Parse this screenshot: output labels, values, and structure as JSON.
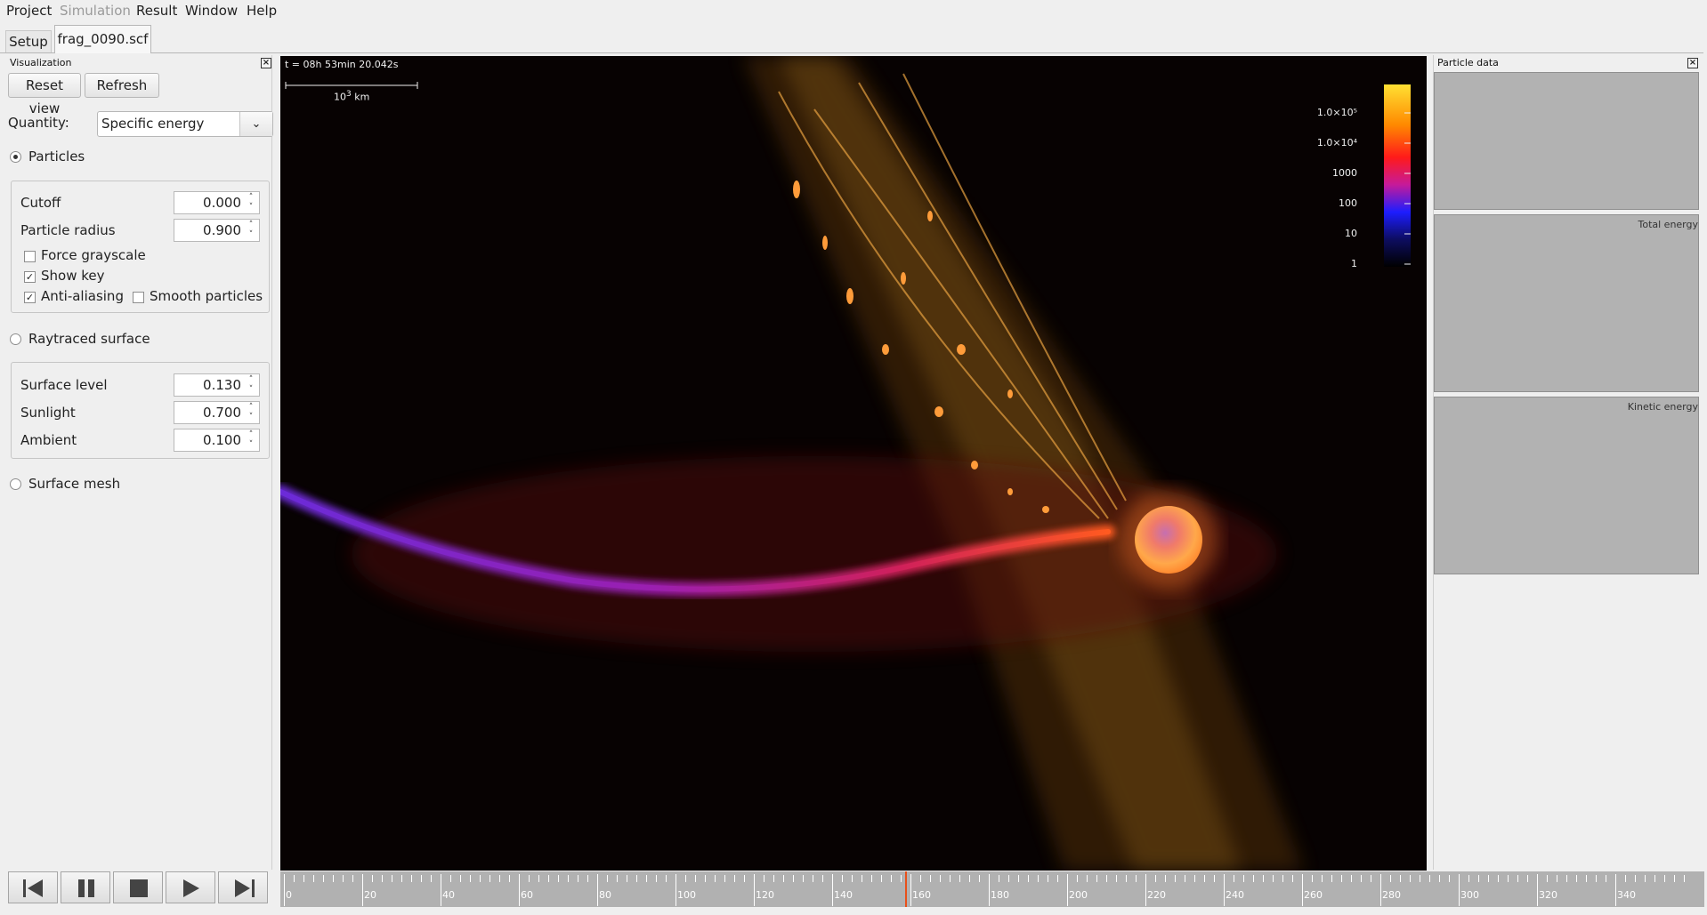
{
  "menu": [
    "Project",
    "Simulation",
    "Result",
    "Window",
    "Help"
  ],
  "tabs": {
    "setup": "Setup",
    "file": "frag_0090.scf"
  },
  "left_panel": {
    "title": "Visualization",
    "reset_view": "Reset view",
    "refresh": "Refresh",
    "quantity_label": "Quantity:",
    "quantity_value": "Specific energy",
    "particles_label": "Particles",
    "cutoff_label": "Cutoff",
    "cutoff_value": "0.000",
    "radius_label": "Particle radius",
    "radius_value": "0.900",
    "force_grayscale": "Force grayscale",
    "show_key": "Show key",
    "anti_aliasing": "Anti-aliasing",
    "smooth_particles": "Smooth particles",
    "raytraced_label": "Raytraced surface",
    "surface_level_label": "Surface level",
    "surface_level_value": "0.130",
    "sunlight_label": "Sunlight",
    "sunlight_value": "0.700",
    "ambient_label": "Ambient",
    "ambient_value": "0.100",
    "surface_mesh_label": "Surface mesh"
  },
  "viewport": {
    "time": "t = 08h 53min 20.042s",
    "scale_label": "10",
    "scale_exp": "3",
    "scale_unit": "km",
    "colorbar_labels": [
      "1.0×10⁵",
      "1.0×10⁴",
      "1000",
      "100",
      "10",
      "1"
    ]
  },
  "right_panel": {
    "title": "Particle data",
    "plot2": "Total energy",
    "plot3": "Kinetic energy"
  },
  "timeline": {
    "labels": [
      "0",
      "20",
      "40",
      "60",
      "80",
      "100",
      "120",
      "140",
      "160",
      "180",
      "200",
      "220",
      "240",
      "260",
      "280",
      "300",
      "320",
      "340"
    ],
    "current": 160
  },
  "colors": {
    "cursor": "#e8501a",
    "timeline_bg": "#b1b1b1",
    "viewport_bg": "#070202"
  },
  "icons": [
    "step-back-icon",
    "pause-icon",
    "stop-icon",
    "play-icon",
    "step-forward-icon",
    "close-icon"
  ]
}
